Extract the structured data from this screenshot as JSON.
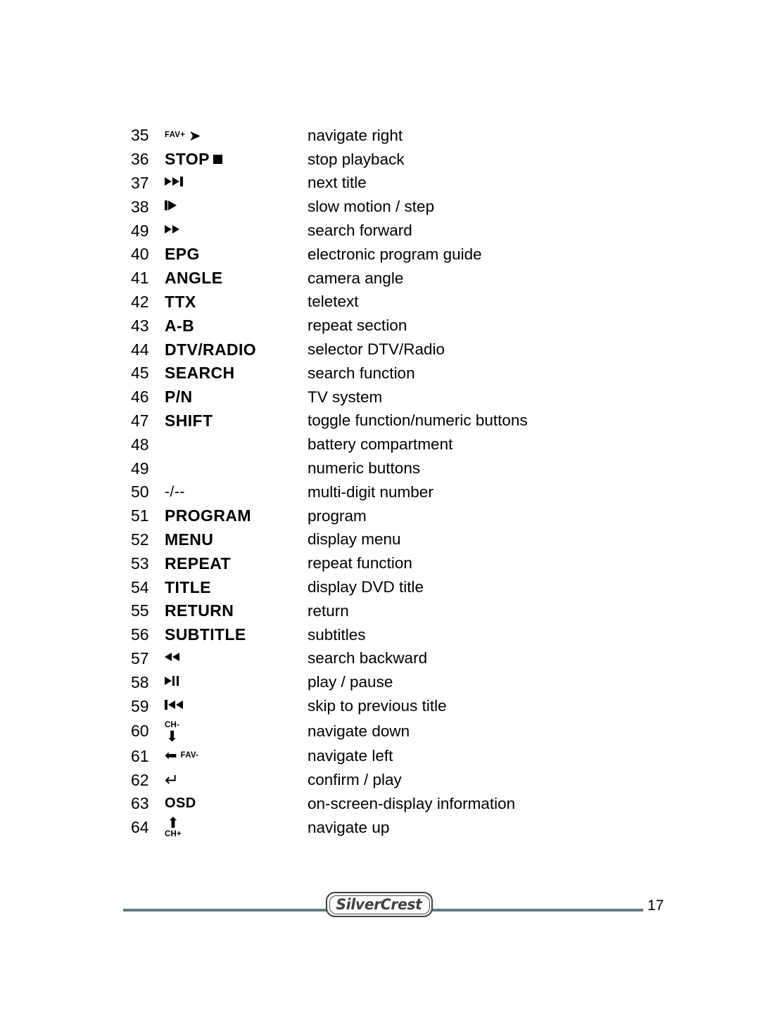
{
  "document": {
    "page_number": "17",
    "footer_logo_text": "SilverCrest",
    "rule_color": "#5f7f81"
  },
  "key_table": {
    "rows": [
      {
        "num": "35",
        "key_text": "FAV+",
        "key_icon": "arrow-right-icon",
        "key_style": "micro-arrow-right",
        "description": "navigate right"
      },
      {
        "num": "36",
        "key_text": "STOP",
        "key_icon": "stop-square-icon",
        "key_style": "bold-with-stop",
        "description": "stop playback"
      },
      {
        "num": "37",
        "key_text": "",
        "key_icon": "next-title-icon",
        "key_style": "icon-next-title",
        "description": "next title"
      },
      {
        "num": "38",
        "key_text": "",
        "key_icon": "slow-motion-icon",
        "key_style": "icon-slow-motion",
        "description": "slow motion / step"
      },
      {
        "num": "49",
        "key_text": "",
        "key_icon": "fast-forward-icon",
        "key_style": "icon-fast-forward",
        "description": "search forward"
      },
      {
        "num": "40",
        "key_text": "EPG",
        "key_icon": "",
        "key_style": "bold",
        "description": "electronic program guide"
      },
      {
        "num": "41",
        "key_text": "ANGLE",
        "key_icon": "",
        "key_style": "bold",
        "description": "camera angle"
      },
      {
        "num": "42",
        "key_text": "TTX",
        "key_icon": "",
        "key_style": "bold",
        "description": "teletext"
      },
      {
        "num": "43",
        "key_text": "A-B",
        "key_icon": "",
        "key_style": "bold",
        "description": "repeat section"
      },
      {
        "num": "44",
        "key_text": "DTV/RADIO",
        "key_icon": "",
        "key_style": "bold",
        "description": "selector DTV/Radio"
      },
      {
        "num": "45",
        "key_text": "SEARCH",
        "key_icon": "",
        "key_style": "bold",
        "description": "search function"
      },
      {
        "num": "46",
        "key_text": "P/N",
        "key_icon": "",
        "key_style": "bold",
        "description": "TV system"
      },
      {
        "num": "47",
        "key_text": "SHIFT",
        "key_icon": "",
        "key_style": "bold",
        "description": "toggle function/numeric buttons"
      },
      {
        "num": "48",
        "key_text": "",
        "key_icon": "",
        "key_style": "none",
        "description": "battery compartment"
      },
      {
        "num": "49",
        "key_text": "",
        "key_icon": "",
        "key_style": "none",
        "description": "numeric buttons"
      },
      {
        "num": "50",
        "key_text": "-/--",
        "key_icon": "",
        "key_style": "plain",
        "description": "multi-digit number"
      },
      {
        "num": "51",
        "key_text": "PROGRAM",
        "key_icon": "",
        "key_style": "bold",
        "description": "program"
      },
      {
        "num": "52",
        "key_text": "MENU",
        "key_icon": "",
        "key_style": "bold",
        "description": "display menu"
      },
      {
        "num": "53",
        "key_text": "REPEAT",
        "key_icon": "",
        "key_style": "bold",
        "description": "repeat function"
      },
      {
        "num": "54",
        "key_text": "TITLE",
        "key_icon": "",
        "key_style": "bold",
        "description": "display DVD title"
      },
      {
        "num": "55",
        "key_text": "RETURN",
        "key_icon": "",
        "key_style": "bold",
        "description": "return"
      },
      {
        "num": "56",
        "key_text": "SUBTITLE",
        "key_icon": "",
        "key_style": "bold",
        "description": "subtitles"
      },
      {
        "num": "57",
        "key_text": "",
        "key_icon": "rewind-icon",
        "key_style": "icon-rewind",
        "description": "search backward"
      },
      {
        "num": "58",
        "key_text": "",
        "key_icon": "play-pause-icon",
        "key_style": "icon-play-pause",
        "description": "play / pause"
      },
      {
        "num": "59",
        "key_text": "",
        "key_icon": "skip-previous-icon",
        "key_style": "icon-skip-previous",
        "description": "skip to previous title"
      },
      {
        "num": "60",
        "key_text": "CH-",
        "key_icon": "arrow-down-icon",
        "key_style": "micro-above-arrow-down",
        "description": "navigate down"
      },
      {
        "num": "61",
        "key_text": "FAV-",
        "key_icon": "arrow-left-icon",
        "key_style": "arrow-left-micro",
        "description": "navigate left"
      },
      {
        "num": "62",
        "key_text": "",
        "key_icon": "enter-return-icon",
        "key_style": "icon-enter",
        "description": "confirm / play"
      },
      {
        "num": "63",
        "key_text": "OSD",
        "key_icon": "",
        "key_style": "bold-small",
        "description": "on-screen-display information"
      },
      {
        "num": "64",
        "key_text": "CH+",
        "key_icon": "arrow-up-icon",
        "key_style": "arrow-up-above-micro",
        "description": "navigate up"
      }
    ]
  }
}
